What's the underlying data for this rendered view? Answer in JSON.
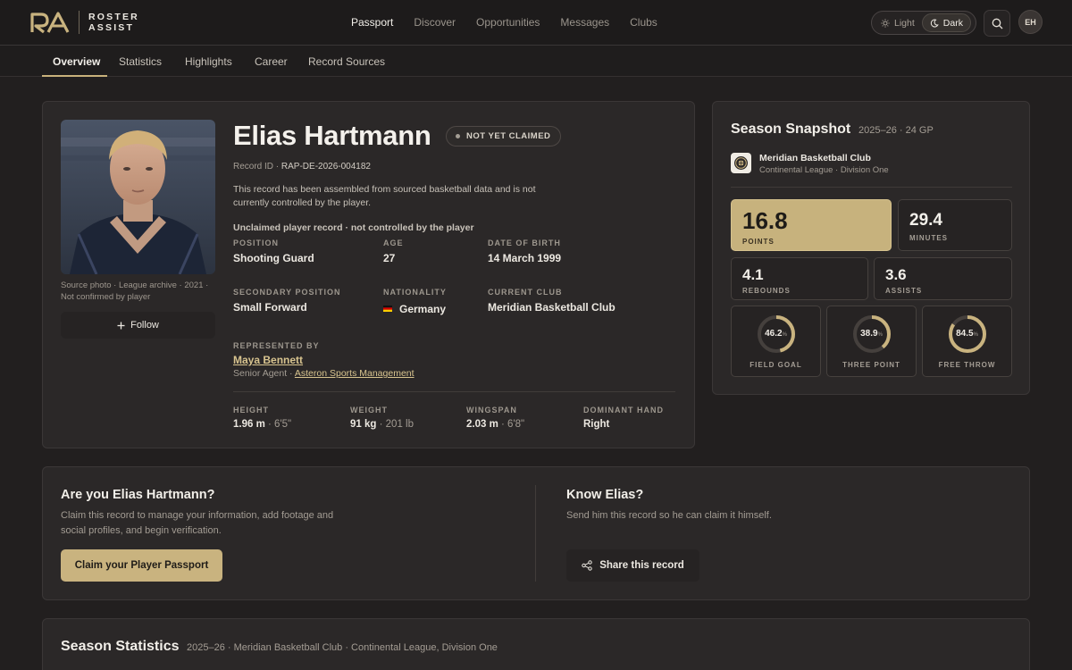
{
  "brand": {
    "name_line1": "ROSTER",
    "name_line2": "ASSIST",
    "colors": {
      "accent": "#c9b37f",
      "background": "#221f1f",
      "card": "#2b2828"
    }
  },
  "nav": {
    "items": [
      "Passport",
      "Discover",
      "Opportunities",
      "Messages",
      "Clubs"
    ],
    "active": "Passport"
  },
  "theme": {
    "light_label": "Light",
    "dark_label": "Dark",
    "selected": "Dark"
  },
  "user": {
    "initials": "EH"
  },
  "subnav": {
    "tabs": [
      "Overview",
      "Statistics",
      "Highlights",
      "Career",
      "Record Sources"
    ],
    "active": "Overview"
  },
  "profile": {
    "name": "Elias Hartmann",
    "claim_status": "NOT YET CLAIMED",
    "record_id_label": "Record ID ·",
    "record_id": "RAP-DE-2026-004182",
    "description": "This record has been assembled from sourced basketball data and is not currently controlled by the player.",
    "unclaimed_note": "Unclaimed player record · not controlled by the player",
    "photo_caption": "Source photo · League archive · 2021 · Not confirmed by player",
    "follow_label": "Follow",
    "fields": {
      "position_label": "POSITION",
      "position": "Shooting Guard",
      "age_label": "AGE",
      "age": "27",
      "dob_label": "DATE OF BIRTH",
      "dob": "14 March 1999",
      "secondary_label": "SECONDARY POSITION",
      "secondary": "Small Forward",
      "nationality_label": "NATIONALITY",
      "nationality": "Germany",
      "club_label": "CURRENT CLUB",
      "club": "Meridian Basketball Club"
    },
    "agent": {
      "label": "REPRESENTED BY",
      "name": "Maya Bennett",
      "role": "Senior Agent ·",
      "agency": "Asteron Sports Management"
    },
    "measurements": {
      "height_label": "HEIGHT",
      "height": "1.96 m",
      "height_imperial": "6'5\"",
      "weight_label": "WEIGHT",
      "weight": "91 kg",
      "weight_imperial": "201 lb",
      "wingspan_label": "WINGSPAN",
      "wingspan": "2.03 m",
      "wingspan_imperial": "6'8\"",
      "hand_label": "DOMINANT HAND",
      "hand": "Right"
    }
  },
  "snapshot": {
    "title": "Season Snapshot",
    "season": "2025–26 · 24 GP",
    "club": "Meridian Basketball Club",
    "league": "Continental League · Division One",
    "stats": {
      "points": "16.8",
      "points_label": "POINTS",
      "minutes": "29.4",
      "minutes_label": "MINUTES",
      "rebounds": "4.1",
      "rebounds_label": "REBOUNDS",
      "assists": "3.6",
      "assists_label": "ASSISTS"
    },
    "percentages": [
      {
        "value": "46.2",
        "unit": "%",
        "label": "FIELD GOAL",
        "fraction": 0.462
      },
      {
        "value": "38.9",
        "unit": "%",
        "label": "THREE POINT",
        "fraction": 0.389
      },
      {
        "value": "84.5",
        "unit": "%",
        "label": "FREE THROW",
        "fraction": 0.845
      }
    ]
  },
  "claim": {
    "title": "Are you Elias Hartmann?",
    "text": "Claim this record to manage your information, add footage and social profiles, and begin verification.",
    "button": "Claim your Player Passport",
    "know_title": "Know Elias?",
    "know_text": "Send him this record so he can claim it himself.",
    "share_button": "Share this record"
  },
  "season_stats": {
    "title": "Season Statistics",
    "subtitle": "2025–26 · Meridian Basketball Club · Continental League, Division One"
  }
}
